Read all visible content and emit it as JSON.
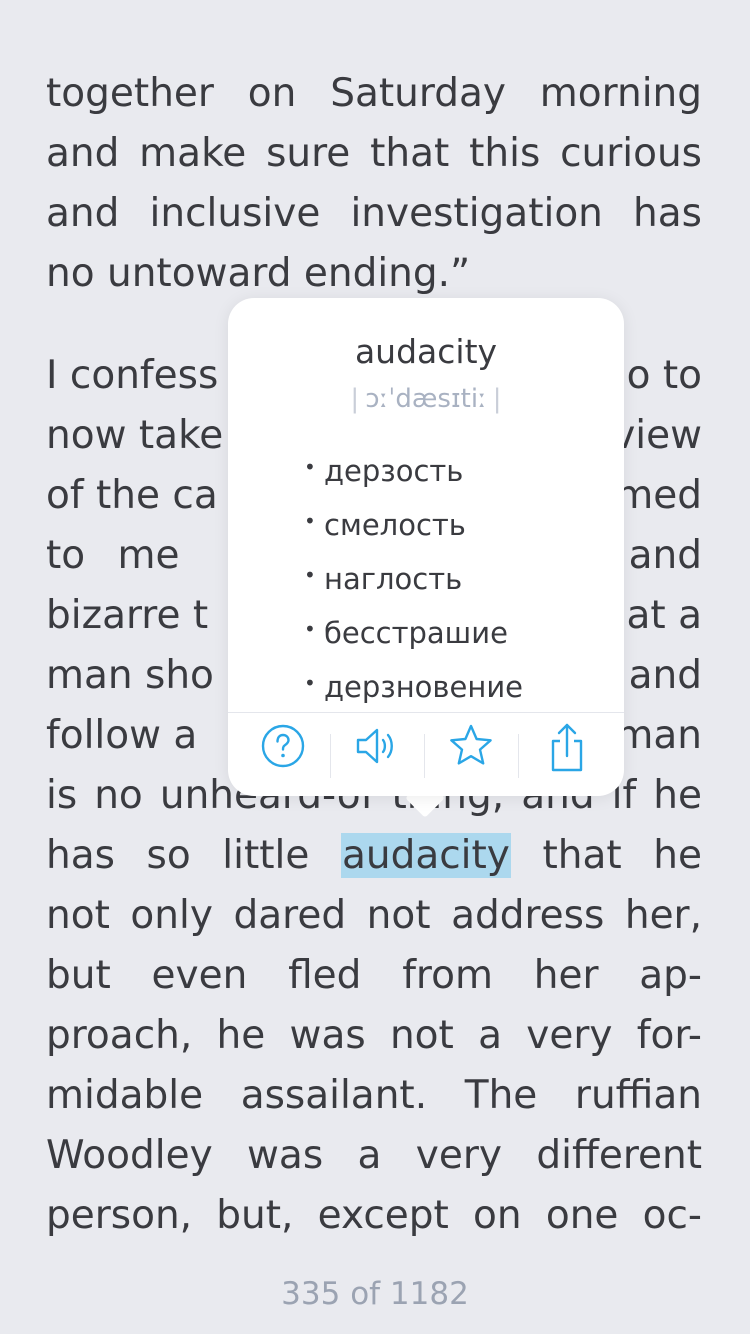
{
  "reader": {
    "paragraph1": [
      "together on Saturday morning",
      "and make sure that this curious",
      "and inclusive investigation has",
      "no untoward ending.”"
    ],
    "paragraph2": [
      "I confess",
      "o to",
      "now take",
      "view",
      "of the ca",
      "med",
      "to me",
      "and",
      "bizarre t",
      "at a",
      "man sho",
      "and",
      "follow a",
      "man",
      "is no unheard-of thing, and if he",
      "has so little",
      "audacity",
      "that he",
      "not only dared not address her,",
      "but even fled from her ap-",
      "proach, he was not a very for-",
      "midable assailant. The ruffian",
      "Woodley was a very different",
      "person, but, except on one oc-"
    ],
    "highlighted_word": "audacity",
    "page_counter": "335 of 1182"
  },
  "popup": {
    "word": "audacity",
    "phonetic": "ɔːˈdæsɪtiː",
    "translations": [
      "дерзость",
      "смелость",
      "наглость",
      "бесстрашие",
      "дерзновение"
    ],
    "actions": [
      {
        "name": "help",
        "icon": "question-circle-icon"
      },
      {
        "name": "pronounce",
        "icon": "speaker-icon"
      },
      {
        "name": "favorite",
        "icon": "star-icon"
      },
      {
        "name": "share",
        "icon": "share-icon"
      }
    ]
  },
  "colors": {
    "background": "#e9eaef",
    "text": "#3a3b40",
    "highlight": "#acd8ee",
    "accent": "#2aa6e6",
    "muted": "#9ba3b2"
  }
}
